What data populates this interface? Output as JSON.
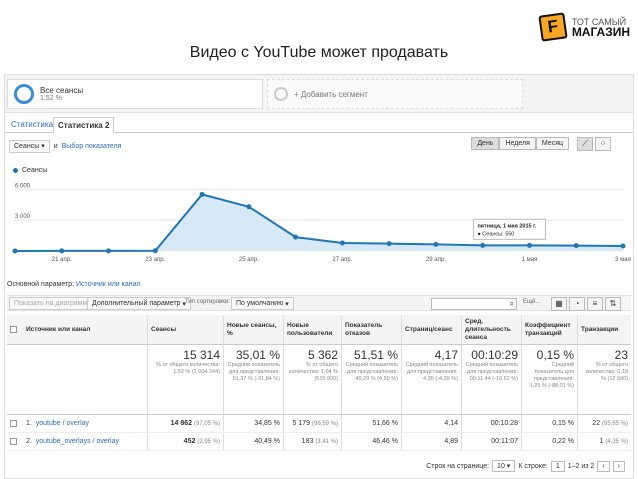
{
  "slide": {
    "title": "Видео с YouTube может продавать"
  },
  "logo": {
    "mark": "F",
    "line1": "ТОТ САМЫЙ",
    "line2": "МАГАЗИН"
  },
  "segments": {
    "seg1_title": "Все сеансы",
    "seg1_sub": "1,52 %",
    "seg2_title": "+ Добавить сегмент"
  },
  "tabs": [
    "Статистика",
    "Статистика 2"
  ],
  "controls": {
    "metric": "Сеансы",
    "and": "и",
    "choose_metric": "Выбор показателя",
    "day": "День",
    "week": "Неделя",
    "month": "Месяц"
  },
  "chart_data": {
    "type": "line",
    "legend": "Сеансы",
    "x": [
      "20 апр.",
      "21 апр.",
      "22 апр.",
      "23 апр.",
      "24 апр.",
      "25 апр.",
      "26 апр.",
      "27 апр.",
      "28 апр.",
      "29 апр.",
      "30 апр.",
      "1 мая",
      "2 мая",
      "3 мая"
    ],
    "x_ticks": [
      "21 апр.",
      "23 апр.",
      "25 апр.",
      "27 апр.",
      "29 апр.",
      "1 мая",
      "3 мая"
    ],
    "values": [
      5,
      8,
      10,
      20,
      5500,
      4300,
      1350,
      780,
      720,
      640,
      550,
      550,
      520,
      490
    ],
    "yticks": [
      "6 000",
      "3 000"
    ],
    "ylim": [
      0,
      7000
    ],
    "tooltip": {
      "title": "пятница, 1 мая 2015 г.",
      "text": "Сеансы: 550"
    }
  },
  "primary": {
    "label": "Основной параметр:",
    "value": "Источник или канал"
  },
  "tools": {
    "secondary_prefix": "Показать на диаграмме",
    "secondary": "Дополнительный параметр",
    "sort_label": "Тип сортировки:",
    "sort": "По умолчанию",
    "more": "Ещё..."
  },
  "table": {
    "headers": [
      "Источник или канал",
      "Сеансы",
      "Новые сеансы, %",
      "Новые пользователи",
      "Показатель отказов",
      "Страниц/сеанс",
      "Сред. длительность сеанса",
      "Коэффициент транзакций",
      "Транзакции"
    ],
    "totals": [
      {
        "big": "15 314",
        "small": "% от общего количества: 1,52 % (1 004 244)"
      },
      {
        "big": "35,01 %",
        "small": "Средний показатель для представления: 51,37 % (-31,84 %)"
      },
      {
        "big": "5 362",
        "small": "% от общего количества: 1,04 % (515 900)"
      },
      {
        "big": "51,51 %",
        "small": "Средний показатель для представления: 49,29 % (4,50 %)"
      },
      {
        "big": "4,17",
        "small": "Средний показатель для представления: 4,35 (-4,29 %)"
      },
      {
        "big": "00:10:29",
        "small": "Средний показатель для представления: 00:11:44 (-10,62 %)"
      },
      {
        "big": "0,15 %",
        "small": "Средний показатель для представления: 1,25 % (-88,01 %)"
      },
      {
        "big": "23",
        "small": "% от общего количества: 0,18 % (12 500)"
      }
    ],
    "rows": [
      {
        "n": "1.",
        "src": "youtube / overlay",
        "sessions": "14 862",
        "s_pct": "(97,05 %)",
        "new_pct": "34,85 %",
        "users": "5 179",
        "u_pct": "(96,59 %)",
        "bounce": "51,66 %",
        "pages": "4,14",
        "dur": "00:10:28",
        "conv": "0,15 %",
        "trans": "22",
        "t_pct": "(95,65 %)"
      },
      {
        "n": "2.",
        "src": "youtube_overlays / overlay",
        "sessions": "452",
        "s_pct": "(2,95 %)",
        "new_pct": "40,49 %",
        "users": "183",
        "u_pct": "(3,41 %)",
        "bounce": "46,46 %",
        "pages": "4,89",
        "dur": "00:11:07",
        "conv": "0,22 %",
        "trans": "1",
        "t_pct": "(4,35 %)"
      }
    ]
  },
  "pager": {
    "rows_label": "Строк на странице:",
    "rows": "10",
    "go_label": "К строке:",
    "go": "1",
    "range": "1–2 из 2"
  }
}
